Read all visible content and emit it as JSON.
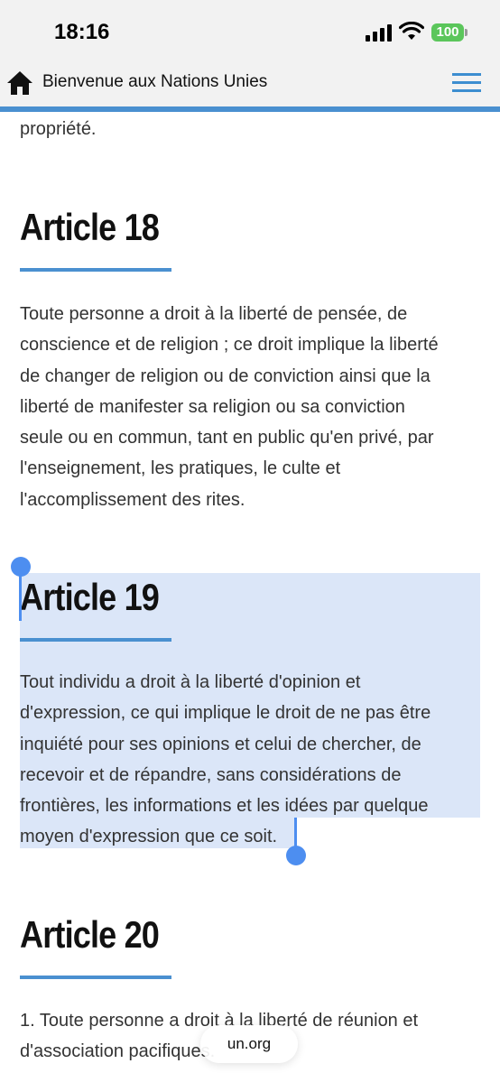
{
  "status_bar": {
    "time": "18:16",
    "battery": "100",
    "battery_color": "#5bc65b"
  },
  "nav": {
    "home_icon": "home-icon",
    "title": "Bienvenue aux Nations Unies",
    "menu_icon": "hamburger-menu-icon",
    "accent_color": "#4a90d0"
  },
  "content": {
    "previous_tail": "propriété.",
    "articles": [
      {
        "title": "Article 18",
        "lines": [
          "Toute personne a droit à la liberté de pensée, de",
          "conscience et de religion ; ce droit implique la liberté",
          "de changer de religion ou de conviction ainsi que la",
          "liberté de manifester sa religion ou sa conviction",
          "seule ou en commun, tant en public qu'en privé, par",
          "l'enseignement, les pratiques, le culte et",
          "l'accomplissement des rites."
        ]
      },
      {
        "title": "Article 19",
        "selected": true,
        "lines": [
          "Tout individu a droit à la liberté d'opinion et",
          "d'expression, ce qui implique le droit de ne pas être",
          "inquiété pour ses opinions et celui de chercher, de",
          "recevoir et de répandre, sans considérations de",
          "frontières, les informations et les idées par quelque",
          "moyen d'expression que ce soit."
        ]
      },
      {
        "title": "Article 20",
        "lines": [
          "1. Toute personne a droit à la liberté de réunion et",
          "d'association pacifiques."
        ]
      }
    ]
  },
  "selection_color": "#dbe6f8",
  "url_bar": {
    "domain": "un.org"
  }
}
